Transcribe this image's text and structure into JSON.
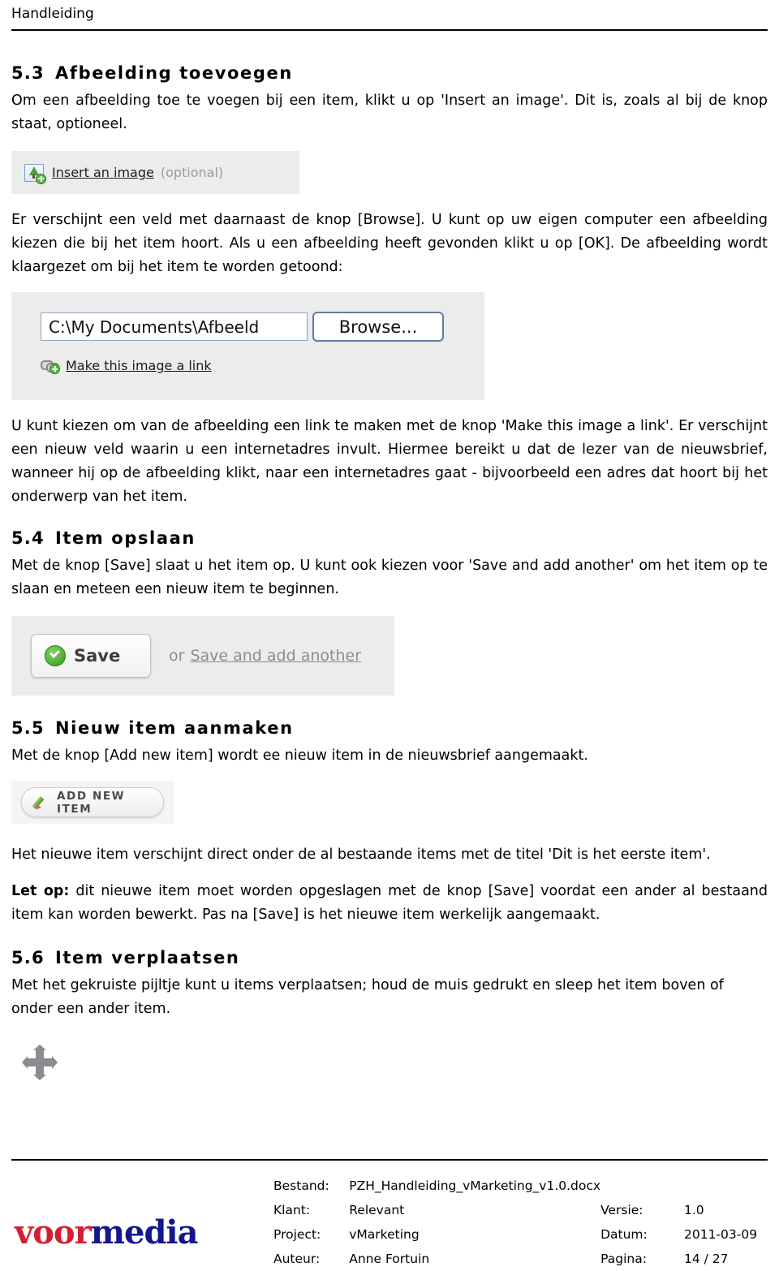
{
  "header": {
    "running_title": "Handleiding"
  },
  "sections": [
    {
      "number": "5.3",
      "title": "Afbeelding toevoegen",
      "paragraph": "Om een afbeelding toe te voegen bij een item, klikt u op 'Insert an image'. Dit is, zoals al bij de knop staat, optioneel."
    },
    {
      "number": "5.4",
      "title": "Item opslaan",
      "paragraph": "Met de knop [Save] slaat u het item op. U kunt ook kiezen voor 'Save and add another' om het item op te slaan en meteen een nieuw item te beginnen."
    },
    {
      "number": "5.5",
      "title": "Nieuw item aanmaken",
      "paragraph": "Met de knop [Add new item] wordt ee nieuw item in de nieuwsbrief aangemaakt."
    },
    {
      "number": "5.6",
      "title": "Item verplaatsen",
      "paragraph": "Met het gekruiste pijltje kunt u items verplaatsen; houd de muis gedrukt en sleep het item boven of onder een ander item."
    }
  ],
  "paragraphs": {
    "after_insert_shot": "Er verschijnt een veld met daarnaast de knop [Browse]. U kunt op uw eigen computer een afbeelding kiezen die bij het item hoort. Als u een afbeelding heeft gevonden klikt u op [OK]. De afbeelding wordt klaargezet om bij het item te worden getoond:",
    "after_browse_shot": "U kunt kiezen om van de afbeelding een link te maken met de knop 'Make this image a link'. Er verschijnt een nieuw veld waarin u een internetadres invult. Hiermee bereikt u dat de lezer van de nieuwsbrief, wanneer hij op de afbeelding klikt, naar een internetadres gaat - bijvoorbeeld een adres dat hoort bij het onderwerp van het item.",
    "after_add_shot": "Het nieuwe item verschijnt direct onder de al bestaande items met de titel 'Dit is het eerste item'.",
    "note_label": "Let op:",
    "note_rest": " dit nieuwe item moet worden opgeslagen met de knop [Save] voordat een ander al bestaand item kan worden bewerkt. Pas na [Save] is het nieuwe item werkelijk aangemaakt."
  },
  "ui_shots": {
    "insert_image": {
      "link_label": "Insert an image",
      "optional_label": "(optional)",
      "icon": "insert-image-icon"
    },
    "browse": {
      "file_path_value": "C:\\My Documents\\Afbeeld",
      "file_path_placeholder": "",
      "browse_button_label": "Browse...",
      "make_link_label": "Make this image a link",
      "link_icon": "chain-link-icon"
    },
    "save": {
      "save_button_label": "Save",
      "or_label": "or",
      "save_add_another_label": "Save and add another",
      "icon": "green-check-icon"
    },
    "add_new_item": {
      "button_label": "ADD NEW ITEM",
      "icon": "pencil-icon"
    },
    "move": {
      "icon": "move-cross-icon"
    }
  },
  "footer": {
    "logo": {
      "part1": "voor",
      "part2": "media",
      "color1": "#d41f32",
      "color2": "#15158f"
    },
    "rows": [
      {
        "key": "Bestand:",
        "value": "PZH_Handleiding_vMarketing_v1.0.docx",
        "key2": "",
        "value2": ""
      },
      {
        "key": "Klant:",
        "value": "Relevant",
        "key2": "Versie:",
        "value2": "1.0"
      },
      {
        "key": "Project:",
        "value": "vMarketing",
        "key2": "Datum:",
        "value2": "2011-03-09"
      },
      {
        "key": "Auteur:",
        "value": "Anne Fortuin",
        "key2": "Pagina:",
        "value2": "14 / 27"
      }
    ]
  }
}
